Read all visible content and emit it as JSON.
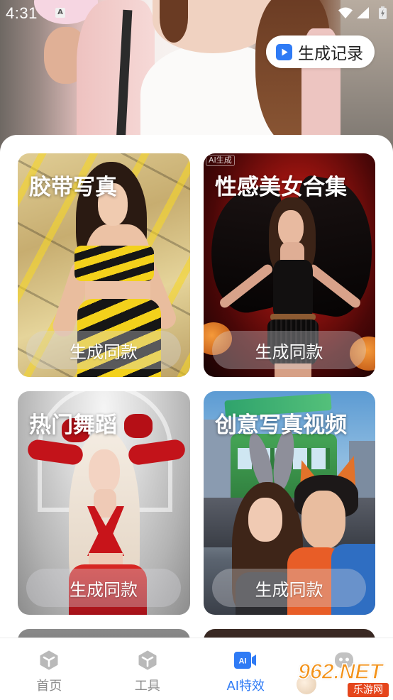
{
  "status_bar": {
    "time": "4:31",
    "notification_glyph": "A",
    "icons": [
      "notification-icon",
      "wifi-icon",
      "signal-icon",
      "battery-icon"
    ],
    "text_color": "#ffffff"
  },
  "header": {
    "history_button": {
      "label": "生成记录",
      "icon": "play-icon"
    }
  },
  "templates": [
    {
      "title": "胶带写真",
      "action_label": "生成同款"
    },
    {
      "title": "性感美女合集",
      "badge": "AI生成",
      "action_label": "生成同款"
    },
    {
      "title": "热门舞蹈",
      "action_label": "生成同款"
    },
    {
      "title": "创意写真视频",
      "action_label": "生成同款"
    }
  ],
  "bottom_nav": {
    "items": [
      {
        "label": "首页",
        "icon": "cube-icon",
        "active": false
      },
      {
        "label": "工具",
        "icon": "cube-icon",
        "active": false
      },
      {
        "label": "AI特效",
        "icon": "ai-camera-icon",
        "icon_text": "AI",
        "active": true
      },
      {
        "icon": "robot-face-icon",
        "active": false
      }
    ]
  },
  "watermark": {
    "logo_text": "962.NET",
    "site_name": "乐游网"
  },
  "colors": {
    "accent": "#2f7bf5",
    "nav_inactive": "#8c8c8c",
    "panel_background": "#ffffff"
  }
}
